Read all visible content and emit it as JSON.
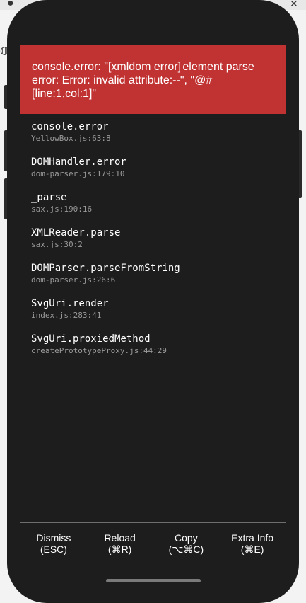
{
  "error": {
    "message": "console.error: \"[xmldom error]\telement parse error: Error: invalid attribute:--\", \"@#[line:1,col:1]\""
  },
  "stack": [
    {
      "method": "console.error",
      "file": "YellowBox.js:63:8"
    },
    {
      "method": "DOMHandler.error",
      "file": "dom-parser.js:179:10"
    },
    {
      "method": "_parse",
      "file": "sax.js:190:16"
    },
    {
      "method": "XMLReader.parse",
      "file": "sax.js:30:2"
    },
    {
      "method": "DOMParser.parseFromString",
      "file": "dom-parser.js:26:6"
    },
    {
      "method": "SvgUri.render",
      "file": "index.js:283:41"
    },
    {
      "method": "SvgUri.proxiedMethod",
      "file": "createPrototypeProxy.js:44:29"
    }
  ],
  "footer": {
    "dismiss": {
      "label": "Dismiss",
      "shortcut": "(ESC)"
    },
    "reload": {
      "label": "Reload",
      "shortcut": "(⌘R)"
    },
    "copy": {
      "label": "Copy",
      "shortcut": "(⌥⌘C)"
    },
    "extra": {
      "label": "Extra Info",
      "shortcut": "(⌘E)"
    }
  },
  "icons": {
    "background_top_left": "github-icon",
    "background_close": "close-icon",
    "background_globe": "globe-icon"
  },
  "colors": {
    "error_red": "#c13232",
    "phone_bg": "#1d1d1d",
    "file_gray": "#9a9a9a"
  }
}
